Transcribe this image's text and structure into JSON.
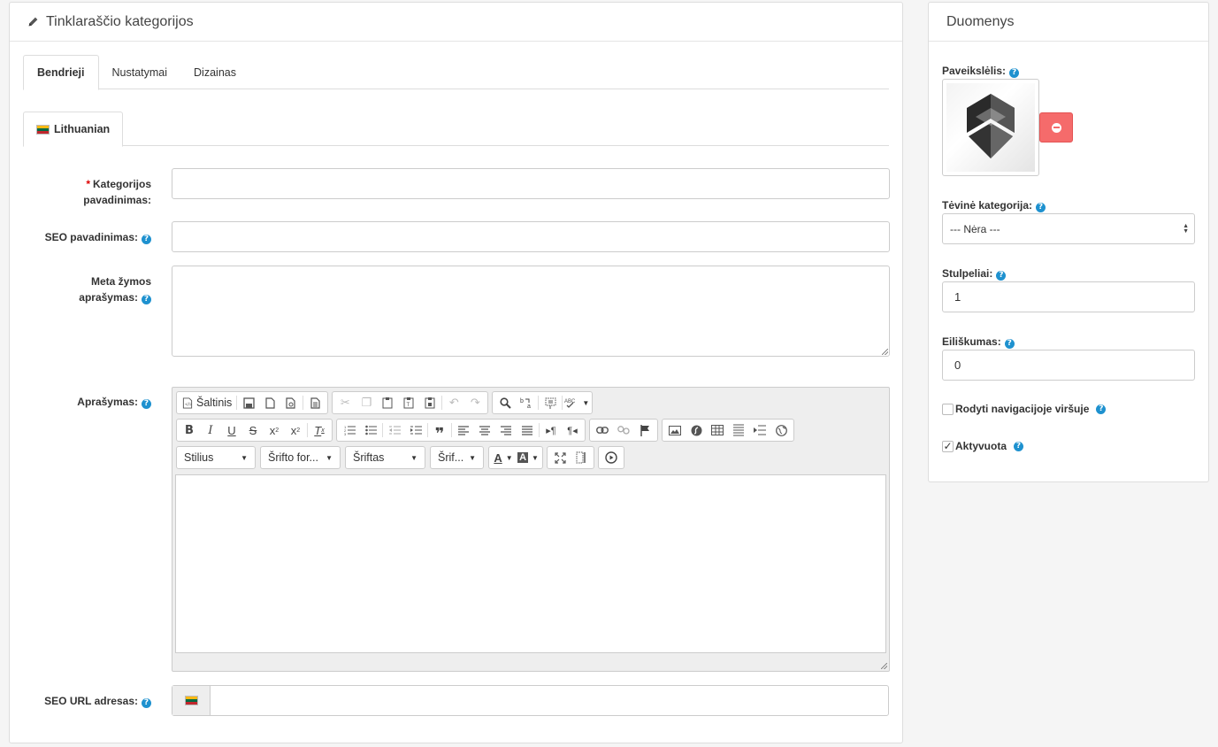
{
  "main": {
    "title": "Tinklaraščio kategorijos",
    "tabs": [
      {
        "label": "Bendrieji"
      },
      {
        "label": "Nustatymai"
      },
      {
        "label": "Dizainas"
      }
    ],
    "language_tab": "Lithuanian",
    "fields": {
      "name_label": "Kategorijos pavadinimas:",
      "seo_name_label": "SEO pavadinimas:",
      "meta_label_1": "Meta žymos",
      "meta_label_2": "aprašymas:",
      "description_label": "Aprašymas:",
      "seo_url_label": "SEO URL adresas:",
      "name_value": "",
      "seo_name_value": "",
      "meta_value": "",
      "seo_url_value": ""
    },
    "editor": {
      "source_label": "Šaltinis",
      "styles_combo": "Stilius",
      "format_combo": "Šrifto for...",
      "font_combo": "Šriftas",
      "size_combo": "Šrif..."
    }
  },
  "side": {
    "title": "Duomenys",
    "image_label": "Paveikslėlis:",
    "parent_label": "Tėvinė kategorija:",
    "parent_value": "--- Nėra ---",
    "columns_label": "Stulpeliai:",
    "columns_value": "1",
    "sort_label": "Eiliškumas:",
    "sort_value": "0",
    "show_nav_label": "Rodyti navigacijoje viršuje",
    "show_nav_checked": false,
    "active_label": "Aktyvuota",
    "active_checked": true
  },
  "colors": {
    "help_icon": "#1e91cf",
    "remove_button": "#f56b6b",
    "required": "#dd0000"
  },
  "help_glyph": "?"
}
